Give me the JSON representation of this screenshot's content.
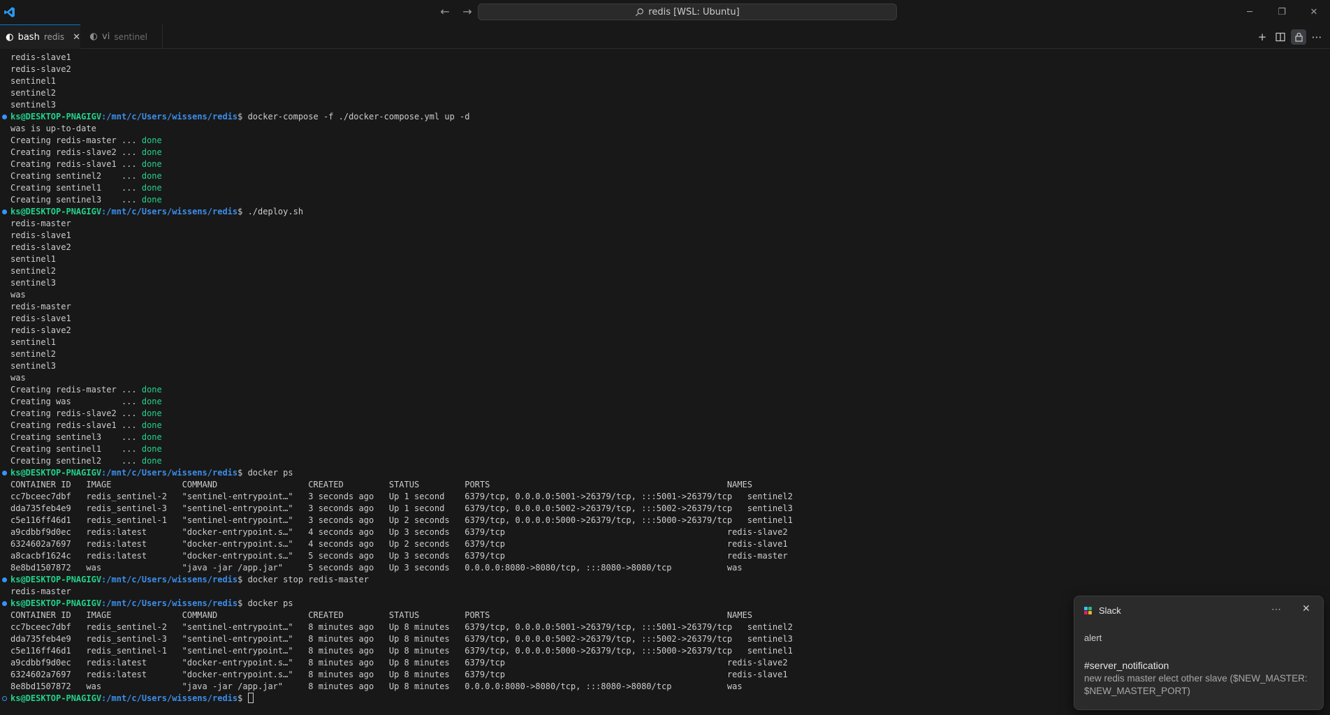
{
  "window": {
    "title": "redis [WSL: Ubuntu]",
    "nav_back": "←",
    "nav_forward": "→",
    "minimize": "─",
    "restore": "❐",
    "close": "✕"
  },
  "tabs": [
    {
      "label": "bash",
      "description": "redis",
      "icon": "terminal-icon",
      "active": true,
      "close": "✕"
    },
    {
      "label": "vi",
      "description": "sentinel",
      "icon": "terminal-icon",
      "active": false
    }
  ],
  "tab_actions": {
    "new_terminal": "+",
    "split": "◫",
    "lock": "🔒",
    "more": "⋯"
  },
  "terminal": {
    "prompt_user": "ks@DESKTOP-PNAGIGV",
    "prompt_path": ":/mnt/c/Users/wissens/redis",
    "prompt_dollar": "$ ",
    "lines": [
      {
        "type": "text",
        "text": "redis-slave1"
      },
      {
        "type": "text",
        "text": "redis-slave2"
      },
      {
        "type": "text",
        "text": "sentinel1"
      },
      {
        "type": "text",
        "text": "sentinel2"
      },
      {
        "type": "text",
        "text": "sentinel3"
      },
      {
        "type": "prompt",
        "cmd": "docker-compose -f ./docker-compose.yml up -d"
      },
      {
        "type": "text",
        "text": "was is up-to-date"
      },
      {
        "type": "status",
        "text": "Creating redis-master ... ",
        "status": "done"
      },
      {
        "type": "status",
        "text": "Creating redis-slave2 ... ",
        "status": "done"
      },
      {
        "type": "status",
        "text": "Creating redis-slave1 ... ",
        "status": "done"
      },
      {
        "type": "status",
        "text": "Creating sentinel2    ... ",
        "status": "done"
      },
      {
        "type": "status",
        "text": "Creating sentinel1    ... ",
        "status": "done"
      },
      {
        "type": "status",
        "text": "Creating sentinel3    ... ",
        "status": "done"
      },
      {
        "type": "prompt",
        "cmd": "./deploy.sh"
      },
      {
        "type": "text",
        "text": "redis-master"
      },
      {
        "type": "text",
        "text": "redis-slave1"
      },
      {
        "type": "text",
        "text": "redis-slave2"
      },
      {
        "type": "text",
        "text": "sentinel1"
      },
      {
        "type": "text",
        "text": "sentinel2"
      },
      {
        "type": "text",
        "text": "sentinel3"
      },
      {
        "type": "text",
        "text": "was"
      },
      {
        "type": "text",
        "text": "redis-master"
      },
      {
        "type": "text",
        "text": "redis-slave1"
      },
      {
        "type": "text",
        "text": "redis-slave2"
      },
      {
        "type": "text",
        "text": "sentinel1"
      },
      {
        "type": "text",
        "text": "sentinel2"
      },
      {
        "type": "text",
        "text": "sentinel3"
      },
      {
        "type": "text",
        "text": "was"
      },
      {
        "type": "status",
        "text": "Creating redis-master ... ",
        "status": "done"
      },
      {
        "type": "status",
        "text": "Creating was          ... ",
        "status": "done"
      },
      {
        "type": "status",
        "text": "Creating redis-slave2 ... ",
        "status": "done"
      },
      {
        "type": "status",
        "text": "Creating redis-slave1 ... ",
        "status": "done"
      },
      {
        "type": "status",
        "text": "Creating sentinel3    ... ",
        "status": "done"
      },
      {
        "type": "status",
        "text": "Creating sentinel1    ... ",
        "status": "done"
      },
      {
        "type": "status",
        "text": "Creating sentinel2    ... ",
        "status": "done"
      },
      {
        "type": "prompt",
        "cmd": "docker ps"
      },
      {
        "type": "text",
        "text": "CONTAINER ID   IMAGE              COMMAND                  CREATED         STATUS         PORTS                                               NAMES"
      },
      {
        "type": "text",
        "text": "cc7bceec7dbf   redis_sentinel-2   \"sentinel-entrypoint…\"   3 seconds ago   Up 1 second    6379/tcp, 0.0.0.0:5001->26379/tcp, :::5001->26379/tcp   sentinel2"
      },
      {
        "type": "text",
        "text": "dda735feb4e9   redis_sentinel-3   \"sentinel-entrypoint…\"   3 seconds ago   Up 1 second    6379/tcp, 0.0.0.0:5002->26379/tcp, :::5002->26379/tcp   sentinel3"
      },
      {
        "type": "text",
        "text": "c5e116ff46d1   redis_sentinel-1   \"sentinel-entrypoint…\"   3 seconds ago   Up 2 seconds   6379/tcp, 0.0.0.0:5000->26379/tcp, :::5000->26379/tcp   sentinel1"
      },
      {
        "type": "text",
        "text": "a9cdbbf9d0ec   redis:latest       \"docker-entrypoint.s…\"   4 seconds ago   Up 3 seconds   6379/tcp                                            redis-slave2"
      },
      {
        "type": "text",
        "text": "6324602a7697   redis:latest       \"docker-entrypoint.s…\"   4 seconds ago   Up 2 seconds   6379/tcp                                            redis-slave1"
      },
      {
        "type": "text",
        "text": "a8cacbf1624c   redis:latest       \"docker-entrypoint.s…\"   5 seconds ago   Up 3 seconds   6379/tcp                                            redis-master"
      },
      {
        "type": "text",
        "text": "8e8bd1507872   was                \"java -jar /app.jar\"     5 seconds ago   Up 3 seconds   0.0.0.0:8080->8080/tcp, :::8080->8080/tcp           was"
      },
      {
        "type": "prompt",
        "cmd": "docker stop redis-master"
      },
      {
        "type": "text",
        "text": "redis-master"
      },
      {
        "type": "prompt",
        "cmd": "docker ps"
      },
      {
        "type": "text",
        "text": "CONTAINER ID   IMAGE              COMMAND                  CREATED         STATUS         PORTS                                               NAMES"
      },
      {
        "type": "text",
        "text": "cc7bceec7dbf   redis_sentinel-2   \"sentinel-entrypoint…\"   8 minutes ago   Up 8 minutes   6379/tcp, 0.0.0.0:5001->26379/tcp, :::5001->26379/tcp   sentinel2"
      },
      {
        "type": "text",
        "text": "dda735feb4e9   redis_sentinel-3   \"sentinel-entrypoint…\"   8 minutes ago   Up 8 minutes   6379/tcp, 0.0.0.0:5002->26379/tcp, :::5002->26379/tcp   sentinel3"
      },
      {
        "type": "text",
        "text": "c5e116ff46d1   redis_sentinel-1   \"sentinel-entrypoint…\"   8 minutes ago   Up 8 minutes   6379/tcp, 0.0.0.0:5000->26379/tcp, :::5000->26379/tcp   sentinel1"
      },
      {
        "type": "text",
        "text": "a9cdbbf9d0ec   redis:latest       \"docker-entrypoint.s…\"   8 minutes ago   Up 8 minutes   6379/tcp                                            redis-slave2"
      },
      {
        "type": "text",
        "text": "6324602a7697   redis:latest       \"docker-entrypoint.s…\"   8 minutes ago   Up 8 minutes   6379/tcp                                            redis-slave1"
      },
      {
        "type": "text",
        "text": "8e8bd1507872   was                \"java -jar /app.jar\"     8 minutes ago   Up 8 minutes   0.0.0.0:8080->8080/tcp, :::8080->8080/tcp           was"
      },
      {
        "type": "prompt",
        "cmd": "",
        "cursor": true
      }
    ]
  },
  "notification": {
    "app": "Slack",
    "more": "⋯",
    "close": "✕",
    "title": "alert",
    "channel": "#server_notification",
    "message": "new redis master elect other slave ($NEW_MASTER: $NEW_MASTER_PORT)"
  },
  "colors": {
    "background": "#181818",
    "accent": "#0078d4",
    "prompt_user": "#23d18b",
    "prompt_path": "#3b8eea",
    "done": "#23d18b"
  }
}
